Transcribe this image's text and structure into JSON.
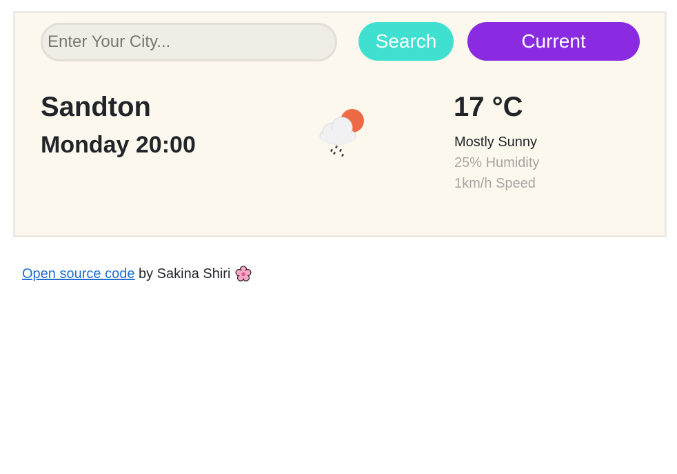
{
  "search": {
    "placeholder": "Enter Your City...",
    "value": "",
    "search_label": "Search",
    "current_label": "Current"
  },
  "weather": {
    "city": "Sandton",
    "datetime": "Monday 20:00",
    "icon": "partly-cloudy-rain-icon",
    "temperature": "17 °C",
    "description": "Mostly Sunny",
    "humidity": "25% Humidity",
    "speed": "1km/h Speed"
  },
  "footer": {
    "link_text": "Open source code",
    "byline": "by Sakina Shiri",
    "icon": "cherry-blossom-icon"
  },
  "colors": {
    "search_button": "#40e0d0",
    "current_button": "#8a2be2",
    "panel_background": "#fdf8ee",
    "link": "#1f6fd1"
  }
}
